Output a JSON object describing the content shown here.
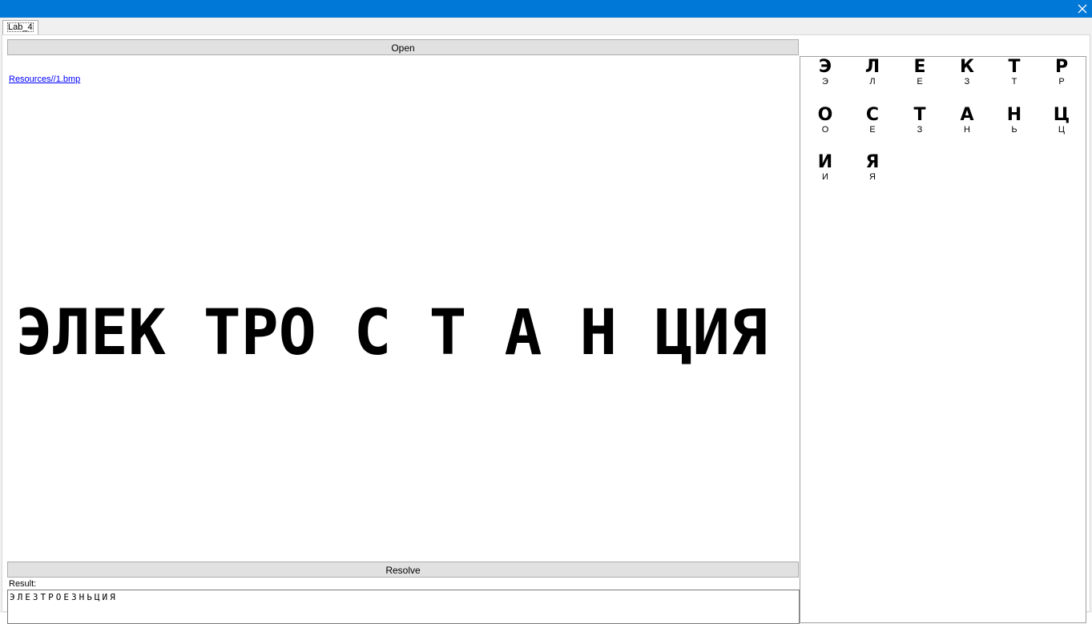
{
  "window": {
    "close_glyph": "✕",
    "titlebar_color": "#0078d7"
  },
  "tabs": [
    {
      "label": "Lab_4",
      "selected": true
    }
  ],
  "controls": {
    "open_label": "Open",
    "file_path": "Resources//1.bmp",
    "resolve_label": "Resolve",
    "result_label": "Result:",
    "result_value": "ЭЛЕЗТРОЕЗНЬЦИЯ"
  },
  "image_text": "ЭЛЕК ТРО С Т А Н ЦИЯ",
  "glyphs": [
    {
      "glyph": "Э",
      "label": "Э"
    },
    {
      "glyph": "Л",
      "label": "Л"
    },
    {
      "glyph": "Е",
      "label": "Е"
    },
    {
      "glyph": "К",
      "label": "З"
    },
    {
      "glyph": "Т",
      "label": "Т"
    },
    {
      "glyph": "Р",
      "label": "Р"
    },
    {
      "glyph": "О",
      "label": "О"
    },
    {
      "glyph": "С",
      "label": "Е"
    },
    {
      "glyph": "Т",
      "label": "З"
    },
    {
      "glyph": "А",
      "label": "Н"
    },
    {
      "glyph": "Н",
      "label": "Ь"
    },
    {
      "glyph": "Ц",
      "label": "Ц"
    },
    {
      "glyph": "И",
      "label": "И"
    },
    {
      "glyph": "Я",
      "label": "Я"
    }
  ]
}
